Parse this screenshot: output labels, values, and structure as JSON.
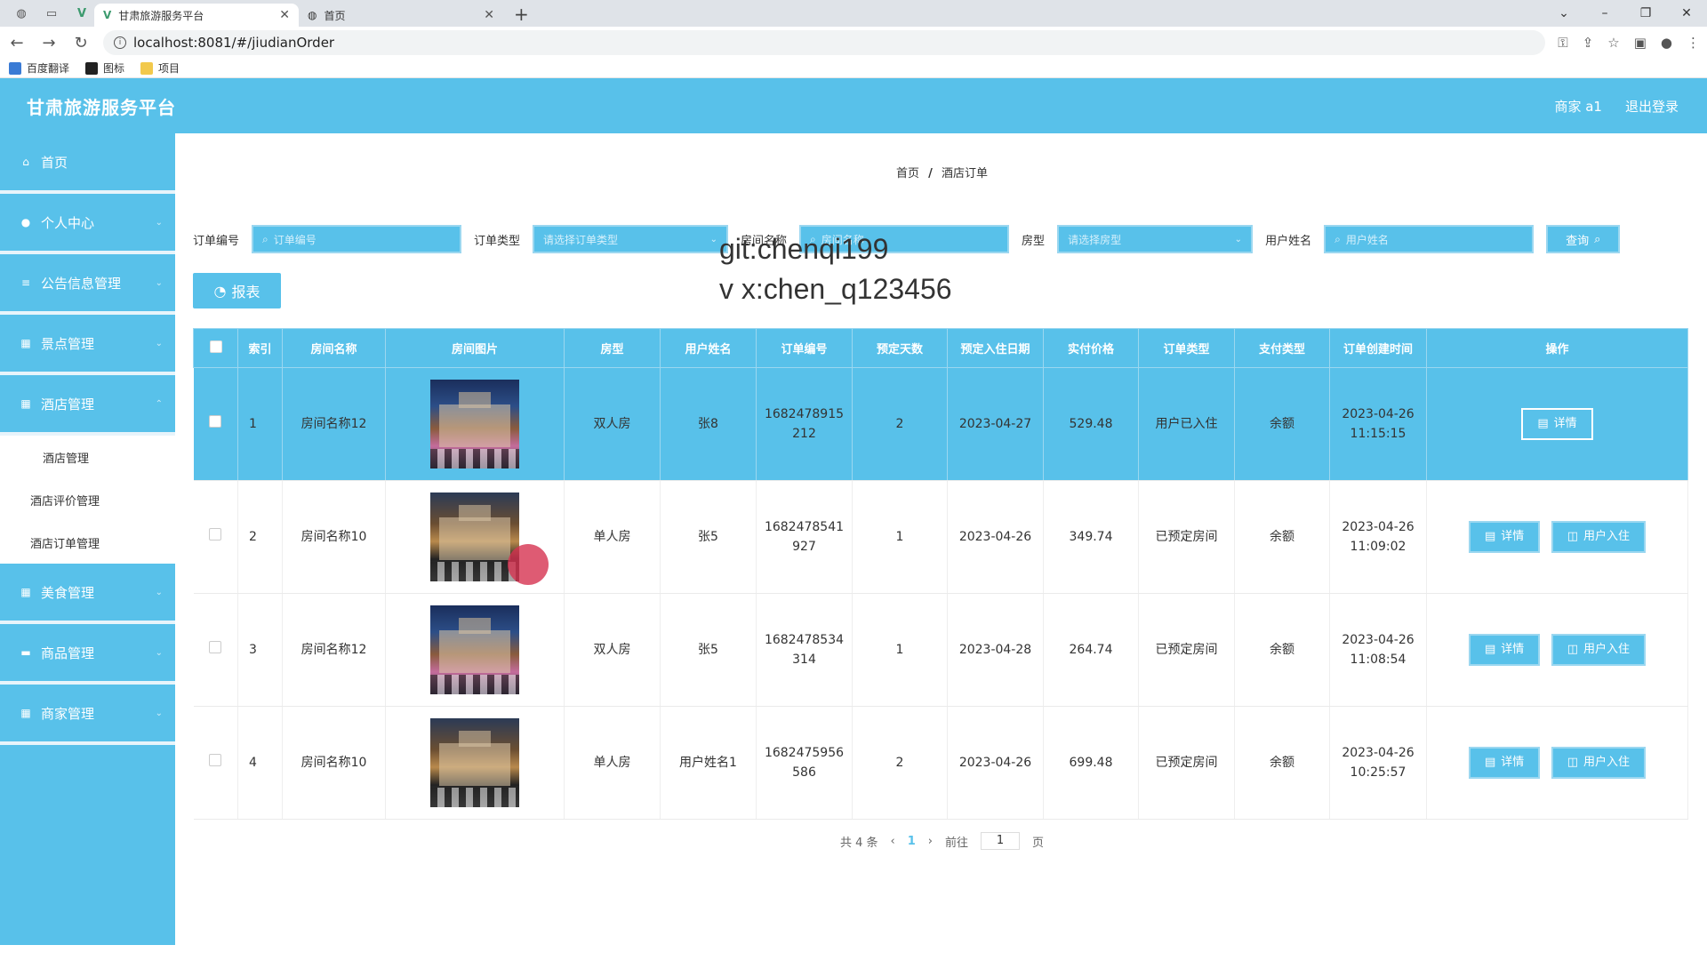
{
  "browser": {
    "tabs": [
      {
        "title": "甘肃旅游服务平台",
        "close": "✕"
      },
      {
        "title": "首页",
        "close": "✕"
      }
    ],
    "new_tab": "+",
    "url": "localhost:8081/#/jiudianOrder",
    "bookmarks": [
      "百度翻译",
      "图标",
      "项目"
    ]
  },
  "header": {
    "title": "甘肃旅游服务平台",
    "user": "商家 a1",
    "logout": "退出登录"
  },
  "sidebar": {
    "items": [
      {
        "label": "首页"
      },
      {
        "label": "个人中心"
      },
      {
        "label": "公告信息管理"
      },
      {
        "label": "景点管理"
      },
      {
        "label": "酒店管理"
      }
    ],
    "sub_items": [
      "酒店管理",
      "酒店评价管理",
      "酒店订单管理"
    ],
    "items_after": [
      {
        "label": "美食管理"
      },
      {
        "label": "商品管理"
      },
      {
        "label": "商家管理"
      }
    ]
  },
  "breadcrumb": {
    "home": "首页",
    "sep": "/",
    "current": "酒店订单"
  },
  "search": {
    "order_no_label": "订单编号",
    "order_no_placeholder": "订单编号",
    "order_type_label": "订单类型",
    "order_type_placeholder": "请选择订单类型",
    "room_name_label": "房间名称",
    "room_name_placeholder": "房间名称",
    "room_type_label": "房型",
    "room_type_placeholder": "请选择房型",
    "user_name_label": "用户姓名",
    "user_name_placeholder": "用户姓名",
    "query_btn": "查询"
  },
  "watermark": {
    "line1": "git:chenqi199",
    "line2": "v x:chen_q123456"
  },
  "report_btn": "报表",
  "table": {
    "headers": [
      "索引",
      "房间名称",
      "房间图片",
      "房型",
      "用户姓名",
      "订单编号",
      "预定天数",
      "预定入住日期",
      "实付价格",
      "订单类型",
      "支付类型",
      "订单创建时间",
      "操作"
    ],
    "rows": [
      {
        "idx": "1",
        "room": "房间名称12",
        "type": "双人房",
        "user": "张8",
        "order_no_1": "1682478915",
        "order_no_2": "212",
        "days": "2",
        "checkin": "2023-04-27",
        "price": "529.48",
        "order_type": "用户已入住",
        "pay": "余额",
        "created_1": "2023-04-26",
        "created_2": "11:15:15"
      },
      {
        "idx": "2",
        "room": "房间名称10",
        "type": "单人房",
        "user": "张5",
        "order_no_1": "1682478541",
        "order_no_2": "927",
        "days": "1",
        "checkin": "2023-04-26",
        "price": "349.74",
        "order_type": "已预定房间",
        "pay": "余额",
        "created_1": "2023-04-26",
        "created_2": "11:09:02"
      },
      {
        "idx": "3",
        "room": "房间名称12",
        "type": "双人房",
        "user": "张5",
        "order_no_1": "1682478534",
        "order_no_2": "314",
        "days": "1",
        "checkin": "2023-04-28",
        "price": "264.74",
        "order_type": "已预定房间",
        "pay": "余额",
        "created_1": "2023-04-26",
        "created_2": "11:08:54"
      },
      {
        "idx": "4",
        "room": "房间名称10",
        "type": "单人房",
        "user": "用户姓名1",
        "order_no_1": "1682475956",
        "order_no_2": "586",
        "days": "2",
        "checkin": "2023-04-26",
        "price": "699.48",
        "order_type": "已预定房间",
        "pay": "余额",
        "created_1": "2023-04-26",
        "created_2": "10:25:57"
      }
    ],
    "detail_btn": "详情",
    "checkin_btn": "用户入住"
  },
  "pager": {
    "total": "共 4 条",
    "current": "1",
    "goto_label": "前往",
    "goto_value": "1",
    "page_suffix": "页"
  },
  "colors": {
    "primary": "#58c1ea"
  }
}
